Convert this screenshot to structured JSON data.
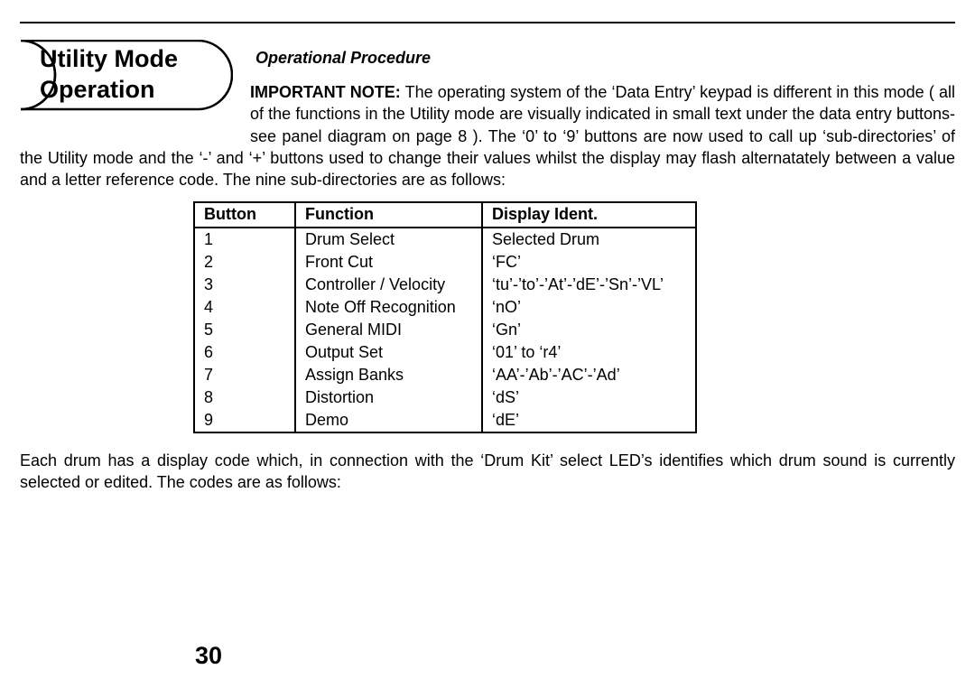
{
  "page_number": "30",
  "tab_title_line1": "Utility Mode",
  "tab_title_line2": "Operation",
  "subtitle": "Operational Procedure",
  "important_label": "IMPORTANT NOTE:",
  "paragraph1_part1": " The operating system of the ‘Data Entry’ keypad is  different in this mode ( all of the functions in the Utility mode are visually indicated in small text under the data entry buttons- see panel diagram on page 8 ).  The  ‘0’ to ‘9’ buttons are now used to call up ‘sub-directories’ of the Utility mode and the ‘-’ and ‘+’ buttons used to change their values whilst the display may flash alternatately between a value and a letter reference code. The nine sub-directories are as follows:",
  "table": {
    "headers": {
      "button": "Button",
      "function": "Function",
      "display_ident": "Display Ident."
    },
    "rows": [
      {
        "button": "1",
        "function": "Drum Select",
        "display_ident": "Selected Drum"
      },
      {
        "button": "2",
        "function": "Front Cut",
        "display_ident": "‘FC’"
      },
      {
        "button": "3",
        "function": "Controller / Velocity",
        "display_ident": "‘tu’-’to’-’At’-’dE’-’Sn’-’VL’"
      },
      {
        "button": "4",
        "function": "Note Off Recognition",
        "display_ident": "‘nO’"
      },
      {
        "button": "5",
        "function": "General MIDI",
        "display_ident": "‘Gn’"
      },
      {
        "button": "6",
        "function": "Output Set",
        "display_ident": "‘01’ to ‘r4’"
      },
      {
        "button": "7",
        "function": "Assign Banks",
        "display_ident": "‘AA’-’Ab’-’AC’-’Ad’"
      },
      {
        "button": "8",
        "function": "Distortion",
        "display_ident": "‘dS’"
      },
      {
        "button": "9",
        "function": "Demo",
        "display_ident": "‘dE’"
      }
    ]
  },
  "paragraph2": "Each drum has a display code which, in connection with the ‘Drum Kit’ select LED’s  identifies which drum sound is currently selected or edited. The codes are as follows:"
}
